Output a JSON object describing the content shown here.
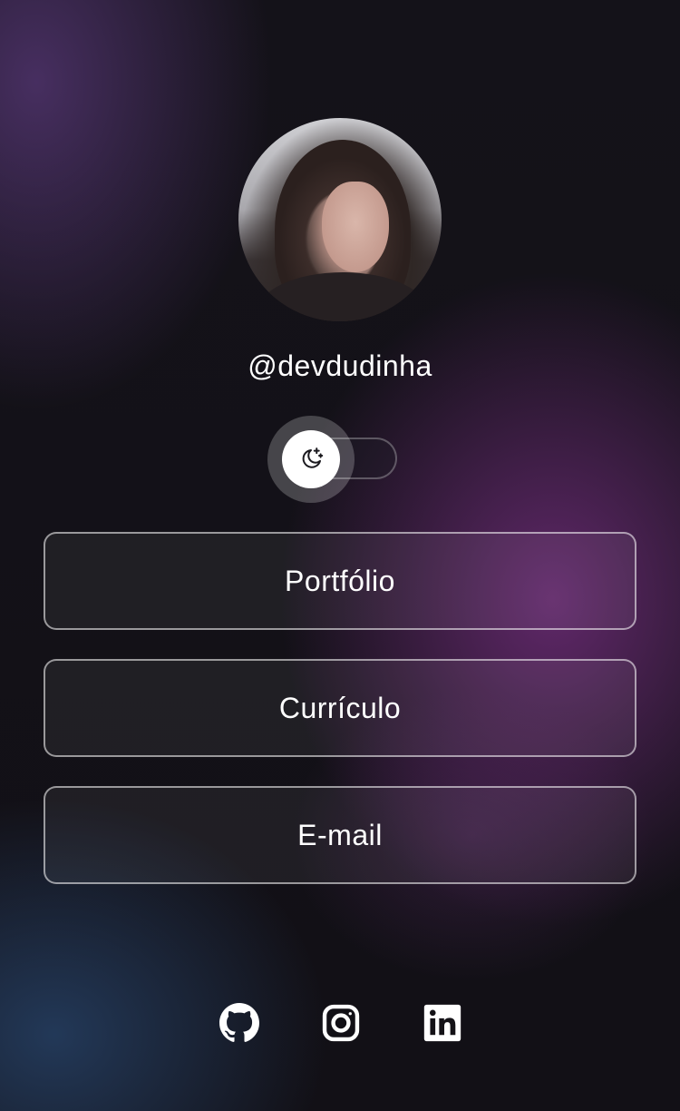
{
  "profile": {
    "username": "@devdudinha",
    "avatar_icon": "profile-photo"
  },
  "theme_toggle": {
    "icon": "moon-stars-icon",
    "state": "dark"
  },
  "links": [
    {
      "label": "Portfólio"
    },
    {
      "label": "Currículo"
    },
    {
      "label": "E-mail"
    }
  ],
  "social": [
    {
      "icon": "github-icon"
    },
    {
      "icon": "instagram-icon"
    },
    {
      "icon": "linkedin-icon"
    }
  ],
  "colors": {
    "background": "#121016",
    "accent_purple": "#6e2c78",
    "text": "#ffffff"
  }
}
